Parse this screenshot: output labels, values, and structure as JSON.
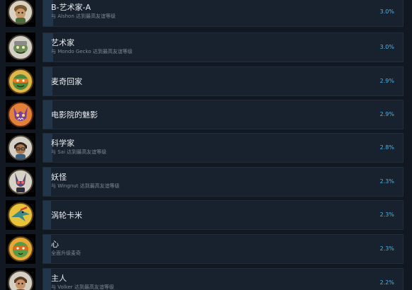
{
  "achievements": [
    {
      "title": "B-艺术家-A",
      "desc": "与 Alshon 达到最高友谊等级",
      "percent": "3.0%",
      "progress": 0.03,
      "icon": "achievement-icon-alshon"
    },
    {
      "title": "艺术家",
      "desc": "与 Mondo Gecko 达到最高友谊等级",
      "percent": "3.0%",
      "progress": 0.03,
      "icon": "achievement-icon-mondo-gecko"
    },
    {
      "title": "麦奇回家",
      "desc": "",
      "percent": "2.9%",
      "progress": 0.029,
      "icon": "achievement-icon-turtle-mask"
    },
    {
      "title": "电影院的魅影",
      "desc": "",
      "percent": "2.9%",
      "progress": 0.029,
      "icon": "achievement-icon-bat-creature"
    },
    {
      "title": "科学家",
      "desc": "与 Sai 达到最高友谊等级",
      "percent": "2.8%",
      "progress": 0.028,
      "icon": "achievement-icon-sai"
    },
    {
      "title": "妖怪",
      "desc": "与 Wingnut 达到最高友谊等级",
      "percent": "2.3%",
      "progress": 0.023,
      "icon": "achievement-icon-wingnut"
    },
    {
      "title": "涡轮卡米",
      "desc": "",
      "percent": "2.3%",
      "progress": 0.023,
      "icon": "achievement-icon-pterodactyl"
    },
    {
      "title": "心",
      "desc": "全面升级麦奇",
      "percent": "2.3%",
      "progress": 0.023,
      "icon": "achievement-icon-turtle-heart"
    },
    {
      "title": "主人",
      "desc": "与 Volker 达到最高友谊等级",
      "percent": "2.2%",
      "progress": 0.022,
      "icon": "achievement-icon-volker"
    }
  ]
}
